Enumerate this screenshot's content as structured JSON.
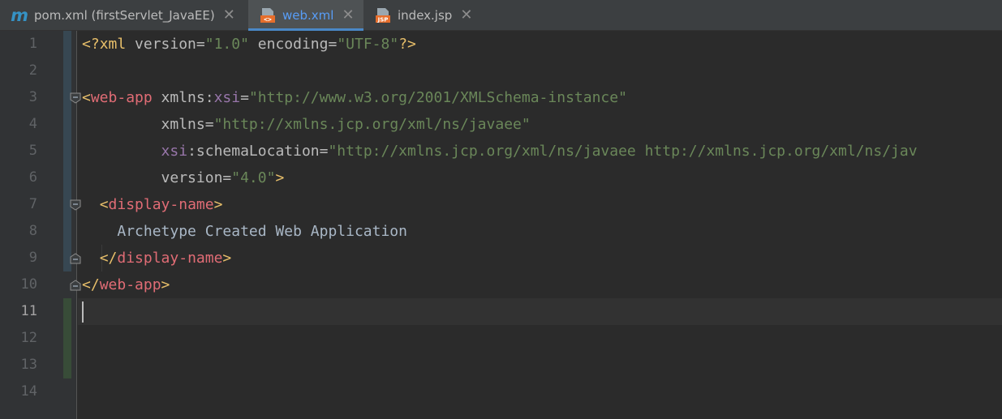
{
  "tabs": [
    {
      "label": "pom.xml (firstServlet_JavaEE)",
      "icon": "maven-icon",
      "active": false
    },
    {
      "label": "web.xml",
      "icon": "xml-file-icon",
      "active": true
    },
    {
      "label": "index.jsp",
      "icon": "jsp-file-icon",
      "active": false
    }
  ],
  "icons": {
    "maven_letter": "m",
    "xml_badge": "<>",
    "jsp_badge": "JSP"
  },
  "close_glyph": "✕",
  "line_numbers": [
    "1",
    "2",
    "3",
    "4",
    "5",
    "6",
    "7",
    "8",
    "9",
    "10",
    "11",
    "12",
    "13",
    "14"
  ],
  "code": {
    "l1": {
      "open": "<?",
      "name": "xml",
      "a1": " version",
      "eq1": "=",
      "v1": "\"1.0\"",
      "a2": " encoding",
      "eq2": "=",
      "v2": "\"UTF-8\"",
      "close": "?>"
    },
    "l3": {
      "open": "<",
      "tag": "web-app",
      "sp": " ",
      "ns1": "xmlns",
      "colon": ":",
      "ns2": "xsi",
      "eq": "=",
      "val": "\"http://www.w3.org/2001/XMLSchema-instance\""
    },
    "l4": {
      "indent": "         ",
      "attr": "xmlns",
      "eq": "=",
      "val": "\"http://xmlns.jcp.org/xml/ns/javaee\""
    },
    "l5": {
      "indent": "         ",
      "ns": "xsi",
      "colon": ":",
      "attr": "schemaLocation",
      "eq": "=",
      "val": "\"http://xmlns.jcp.org/xml/ns/javaee http://xmlns.jcp.org/xml/ns/jav"
    },
    "l6": {
      "indent": "         ",
      "attr": "version",
      "eq": "=",
      "val": "\"4.0\"",
      "close": ">"
    },
    "l7": {
      "indent": "  ",
      "open": "<",
      "tag": "display-name",
      "close": ">"
    },
    "l8": {
      "indent": "    ",
      "text": "Archetype Created Web Application"
    },
    "l9": {
      "indent": "  ",
      "open": "</",
      "tag": "display-name",
      "close": ">"
    },
    "l10": {
      "open": "</",
      "tag": "web-app",
      "close": ">"
    }
  },
  "colors": {
    "tab_active_underline": "#4a88c7",
    "vcs_changed": "#384c38",
    "vcs_modified": "#374752",
    "background": "#2b2b2b"
  }
}
